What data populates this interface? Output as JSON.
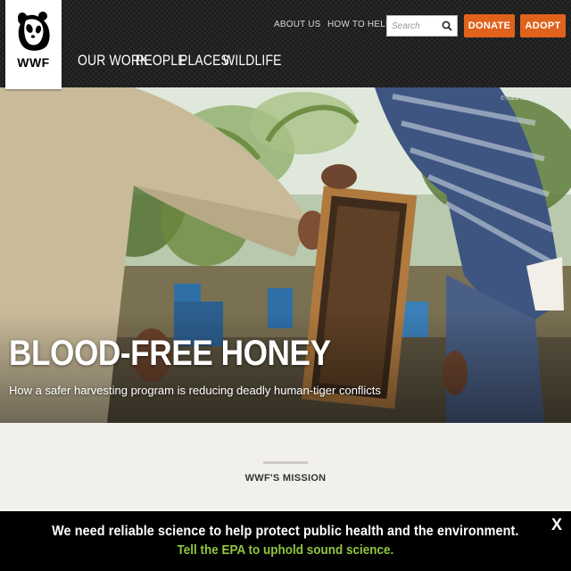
{
  "header": {
    "logo_text": "WWF",
    "utility_links": [
      "ABOUT US",
      "HOW TO HELP"
    ],
    "search": {
      "placeholder": "Search"
    },
    "donate_label": "DONATE",
    "adopt_label": "ADOPT",
    "nav": [
      "OUR WORK",
      "PEOPLE",
      "PLACES",
      "WILDLIFE"
    ]
  },
  "hero": {
    "credit": "© Ratul Saha / WWF-India",
    "title": "BLOOD-FREE HONEY",
    "subtitle": "How a safer harvesting program is reducing deadly human-tiger conflicts"
  },
  "mission": {
    "title": "WWF'S MISSION"
  },
  "banner": {
    "text": "We need reliable science to help protect public health and the environment.",
    "link": "Tell the EPA to uphold sound science.",
    "close": "X"
  },
  "colors": {
    "header_bg": "#1a1a1a",
    "accent_orange": "#e0621b",
    "banner_bg": "#000000",
    "link_green": "#8fc63f",
    "page_bg": "#f2f0ed"
  }
}
